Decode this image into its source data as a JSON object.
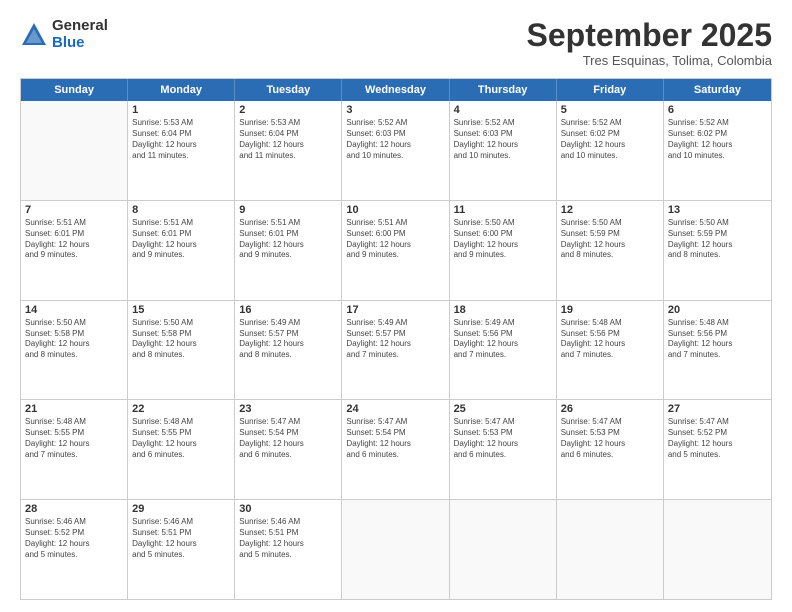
{
  "logo": {
    "general": "General",
    "blue": "Blue"
  },
  "title": "September 2025",
  "subtitle": "Tres Esquinas, Tolima, Colombia",
  "days": [
    "Sunday",
    "Monday",
    "Tuesday",
    "Wednesday",
    "Thursday",
    "Friday",
    "Saturday"
  ],
  "weeks": [
    [
      {
        "date": "",
        "info": ""
      },
      {
        "date": "1",
        "info": "Sunrise: 5:53 AM\nSunset: 6:04 PM\nDaylight: 12 hours\nand 11 minutes."
      },
      {
        "date": "2",
        "info": "Sunrise: 5:53 AM\nSunset: 6:04 PM\nDaylight: 12 hours\nand 11 minutes."
      },
      {
        "date": "3",
        "info": "Sunrise: 5:52 AM\nSunset: 6:03 PM\nDaylight: 12 hours\nand 10 minutes."
      },
      {
        "date": "4",
        "info": "Sunrise: 5:52 AM\nSunset: 6:03 PM\nDaylight: 12 hours\nand 10 minutes."
      },
      {
        "date": "5",
        "info": "Sunrise: 5:52 AM\nSunset: 6:02 PM\nDaylight: 12 hours\nand 10 minutes."
      },
      {
        "date": "6",
        "info": "Sunrise: 5:52 AM\nSunset: 6:02 PM\nDaylight: 12 hours\nand 10 minutes."
      }
    ],
    [
      {
        "date": "7",
        "info": "Sunrise: 5:51 AM\nSunset: 6:01 PM\nDaylight: 12 hours\nand 9 minutes."
      },
      {
        "date": "8",
        "info": "Sunrise: 5:51 AM\nSunset: 6:01 PM\nDaylight: 12 hours\nand 9 minutes."
      },
      {
        "date": "9",
        "info": "Sunrise: 5:51 AM\nSunset: 6:01 PM\nDaylight: 12 hours\nand 9 minutes."
      },
      {
        "date": "10",
        "info": "Sunrise: 5:51 AM\nSunset: 6:00 PM\nDaylight: 12 hours\nand 9 minutes."
      },
      {
        "date": "11",
        "info": "Sunrise: 5:50 AM\nSunset: 6:00 PM\nDaylight: 12 hours\nand 9 minutes."
      },
      {
        "date": "12",
        "info": "Sunrise: 5:50 AM\nSunset: 5:59 PM\nDaylight: 12 hours\nand 8 minutes."
      },
      {
        "date": "13",
        "info": "Sunrise: 5:50 AM\nSunset: 5:59 PM\nDaylight: 12 hours\nand 8 minutes."
      }
    ],
    [
      {
        "date": "14",
        "info": "Sunrise: 5:50 AM\nSunset: 5:58 PM\nDaylight: 12 hours\nand 8 minutes."
      },
      {
        "date": "15",
        "info": "Sunrise: 5:50 AM\nSunset: 5:58 PM\nDaylight: 12 hours\nand 8 minutes."
      },
      {
        "date": "16",
        "info": "Sunrise: 5:49 AM\nSunset: 5:57 PM\nDaylight: 12 hours\nand 8 minutes."
      },
      {
        "date": "17",
        "info": "Sunrise: 5:49 AM\nSunset: 5:57 PM\nDaylight: 12 hours\nand 7 minutes."
      },
      {
        "date": "18",
        "info": "Sunrise: 5:49 AM\nSunset: 5:56 PM\nDaylight: 12 hours\nand 7 minutes."
      },
      {
        "date": "19",
        "info": "Sunrise: 5:48 AM\nSunset: 5:56 PM\nDaylight: 12 hours\nand 7 minutes."
      },
      {
        "date": "20",
        "info": "Sunrise: 5:48 AM\nSunset: 5:56 PM\nDaylight: 12 hours\nand 7 minutes."
      }
    ],
    [
      {
        "date": "21",
        "info": "Sunrise: 5:48 AM\nSunset: 5:55 PM\nDaylight: 12 hours\nand 7 minutes."
      },
      {
        "date": "22",
        "info": "Sunrise: 5:48 AM\nSunset: 5:55 PM\nDaylight: 12 hours\nand 6 minutes."
      },
      {
        "date": "23",
        "info": "Sunrise: 5:47 AM\nSunset: 5:54 PM\nDaylight: 12 hours\nand 6 minutes."
      },
      {
        "date": "24",
        "info": "Sunrise: 5:47 AM\nSunset: 5:54 PM\nDaylight: 12 hours\nand 6 minutes."
      },
      {
        "date": "25",
        "info": "Sunrise: 5:47 AM\nSunset: 5:53 PM\nDaylight: 12 hours\nand 6 minutes."
      },
      {
        "date": "26",
        "info": "Sunrise: 5:47 AM\nSunset: 5:53 PM\nDaylight: 12 hours\nand 6 minutes."
      },
      {
        "date": "27",
        "info": "Sunrise: 5:47 AM\nSunset: 5:52 PM\nDaylight: 12 hours\nand 5 minutes."
      }
    ],
    [
      {
        "date": "28",
        "info": "Sunrise: 5:46 AM\nSunset: 5:52 PM\nDaylight: 12 hours\nand 5 minutes."
      },
      {
        "date": "29",
        "info": "Sunrise: 5:46 AM\nSunset: 5:51 PM\nDaylight: 12 hours\nand 5 minutes."
      },
      {
        "date": "30",
        "info": "Sunrise: 5:46 AM\nSunset: 5:51 PM\nDaylight: 12 hours\nand 5 minutes."
      },
      {
        "date": "",
        "info": ""
      },
      {
        "date": "",
        "info": ""
      },
      {
        "date": "",
        "info": ""
      },
      {
        "date": "",
        "info": ""
      }
    ]
  ]
}
